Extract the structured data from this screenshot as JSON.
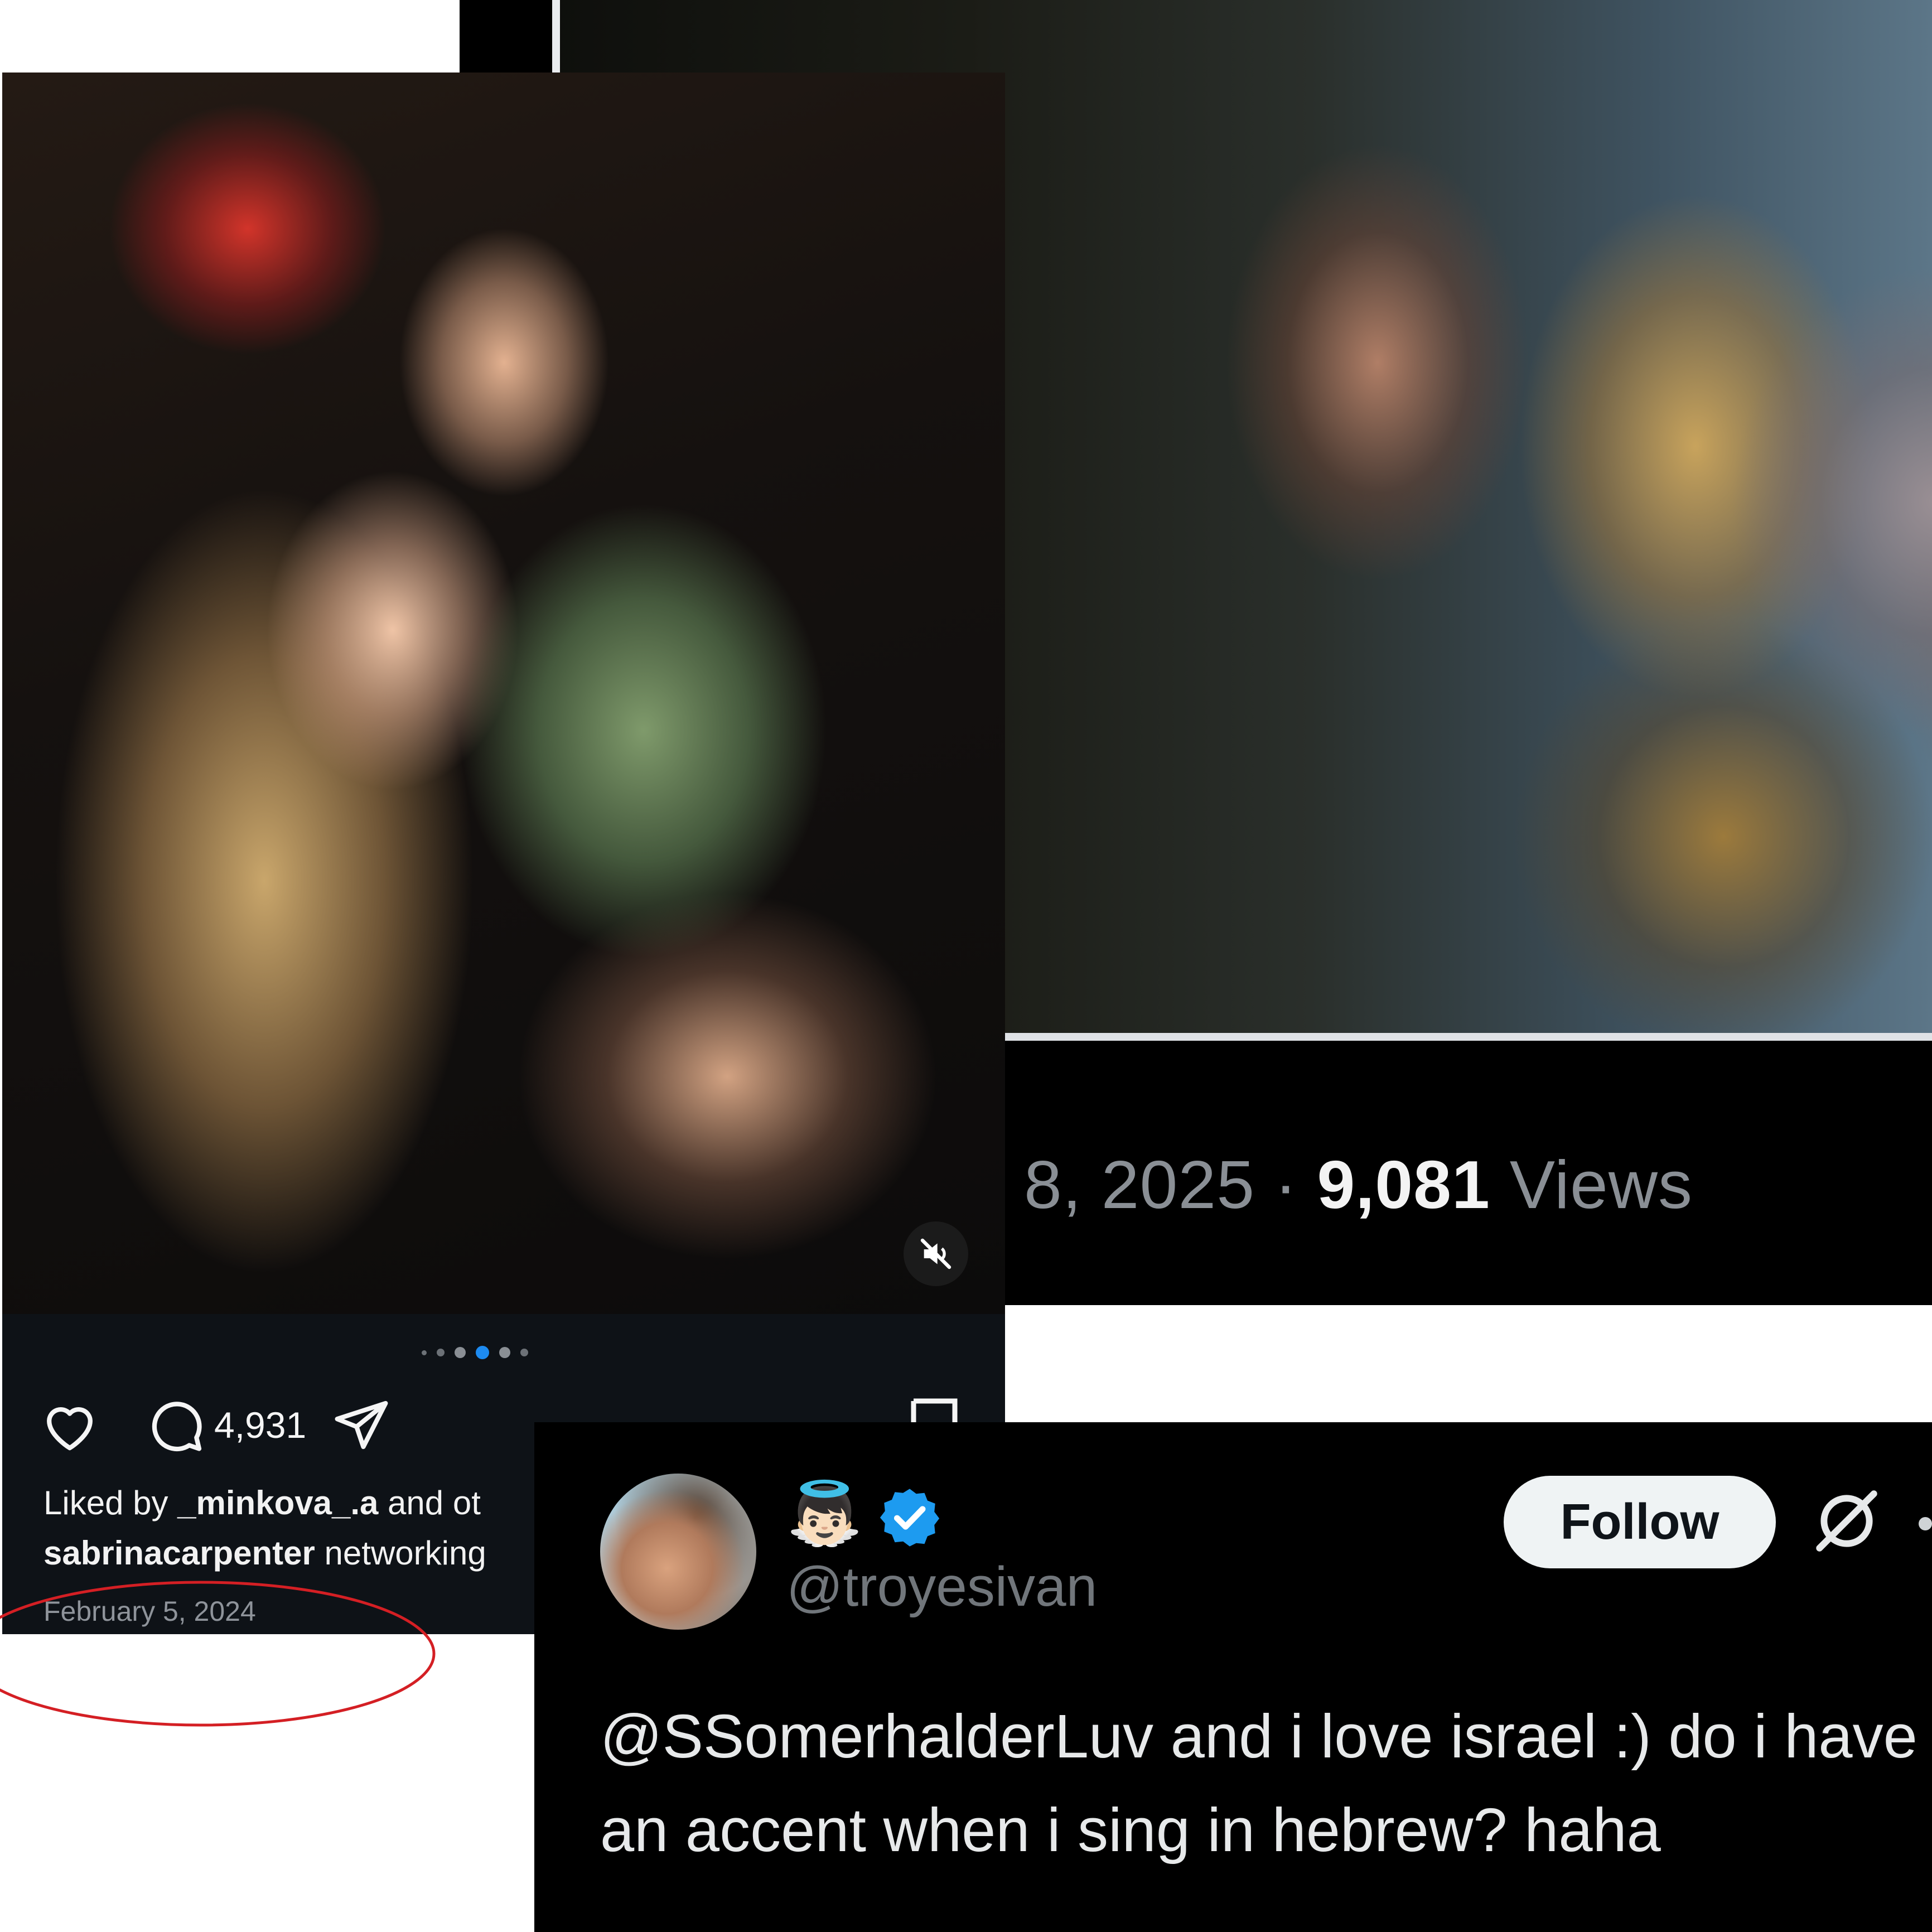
{
  "x_post_header": {
    "date": "8, 2025",
    "views_count": "9,081",
    "views_label": "Views"
  },
  "instagram_post": {
    "comment_count": "4,931",
    "liked_by": {
      "prefix": "Liked by ",
      "user": "_minkova_.a",
      "suffix": " and ot"
    },
    "caption": {
      "user": "sabrinacarpenter",
      "text": " networking"
    },
    "date": "February 5, 2024",
    "carousel_dots": 6,
    "active_dot": 3,
    "icons": [
      "heart-icon",
      "comment-icon",
      "share-icon",
      "bookmark-icon",
      "mute-icon"
    ]
  },
  "x_tweet": {
    "display_emoji": "👼🏻",
    "handle": "@troyesivan",
    "follow_label": "Follow",
    "text": "@SSomerhalderLuv and i love israel :) do i have an accent when i sing in hebrew? haha"
  },
  "colors": {
    "x_verified_blue": "#1d9bf0",
    "annotation_red": "#d41f24",
    "instagram_active_dot": "#1d8bf1"
  }
}
